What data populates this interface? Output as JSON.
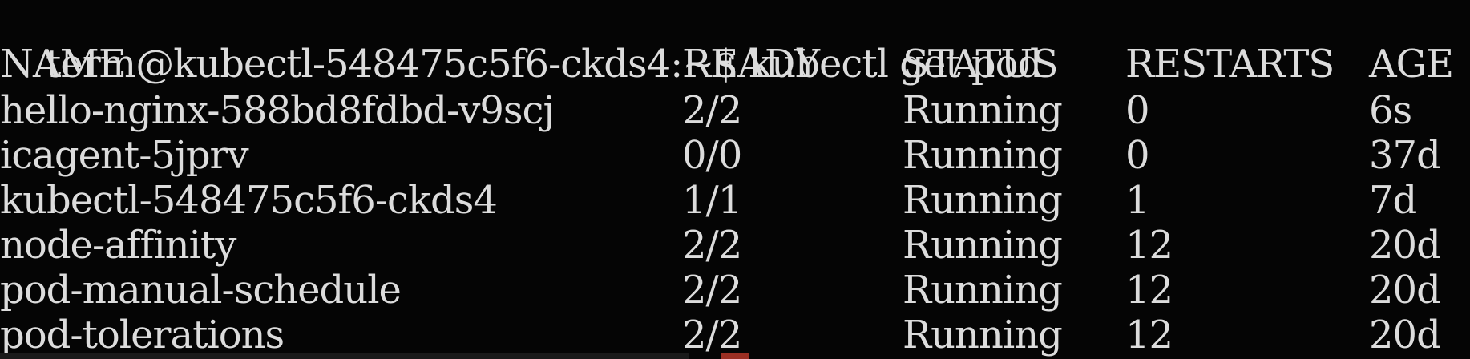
{
  "prompt": {
    "text": "term@kubectl-548475c5f6-ckds4:~$ kubectl get pod"
  },
  "table": {
    "headers": {
      "name": "NAME",
      "ready": "READY",
      "status": "STATUS",
      "restarts": "RESTARTS",
      "age": "AGE"
    },
    "rows": [
      {
        "name": "hello-nginx-588bd8fdbd-v9scj",
        "ready": "2/2",
        "status": "Running",
        "restarts": "0",
        "age": "6s"
      },
      {
        "name": "icagent-5jprv",
        "ready": "0/0",
        "status": "Running",
        "restarts": "0",
        "age": "37d"
      },
      {
        "name": "kubectl-548475c5f6-ckds4",
        "ready": "1/1",
        "status": "Running",
        "restarts": "1",
        "age": "7d"
      },
      {
        "name": "node-affinity",
        "ready": "2/2",
        "status": "Running",
        "restarts": "12",
        "age": "20d"
      },
      {
        "name": "pod-manual-schedule",
        "ready": "2/2",
        "status": "Running",
        "restarts": "12",
        "age": "20d"
      },
      {
        "name": "pod-tolerations",
        "ready": "2/2",
        "status": "Running",
        "restarts": "12",
        "age": "20d"
      }
    ]
  }
}
